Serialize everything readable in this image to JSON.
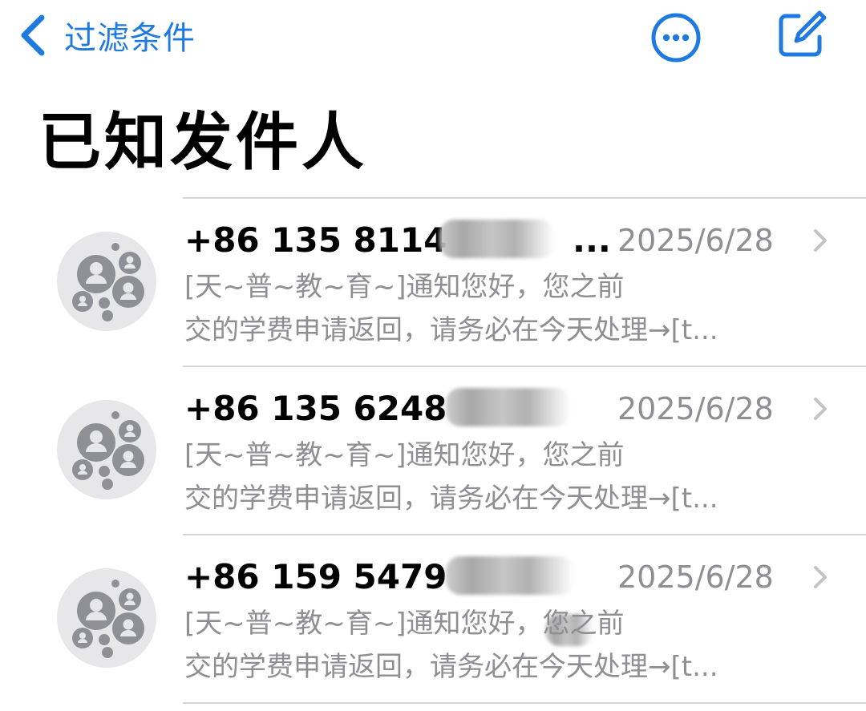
{
  "nav": {
    "back_label": "过滤条件"
  },
  "page": {
    "title": "已知发件人"
  },
  "colors": {
    "accent": "#1f7ae0",
    "secondary_text": "#8e8e93",
    "divider": "#d6d6d6",
    "avatar_bg": "#e7e7ea",
    "avatar_fg": "#8f9096"
  },
  "icons": {
    "back": "chevron-left-icon",
    "more": "ellipsis-circle-icon",
    "compose": "compose-icon",
    "avatar": "group-avatar-icon",
    "disclosure": "chevron-right-icon"
  },
  "messages": [
    {
      "sender": "+86 135 8114",
      "ellipsis": "...",
      "date": "2025/6/28",
      "preview_line1": "[天~普~教~育~]通知您好，您之前",
      "preview_line2": "交的学费申请返回，请务必在今天处理→[t..."
    },
    {
      "sender": "+86 135 6248",
      "ellipsis": "",
      "date": "2025/6/28",
      "preview_line1": "[天~普~教~育~]通知您好，您之前",
      "preview_line2": "交的学费申请返回，请务必在今天处理→[t..."
    },
    {
      "sender": "+86 159 5479",
      "ellipsis": "",
      "date": "2025/6/28",
      "preview_line1": "[天~普~教~育~]通知您好，您之前",
      "preview_line2": "交的学费申请返回，请务必在今天处理→[t..."
    }
  ]
}
